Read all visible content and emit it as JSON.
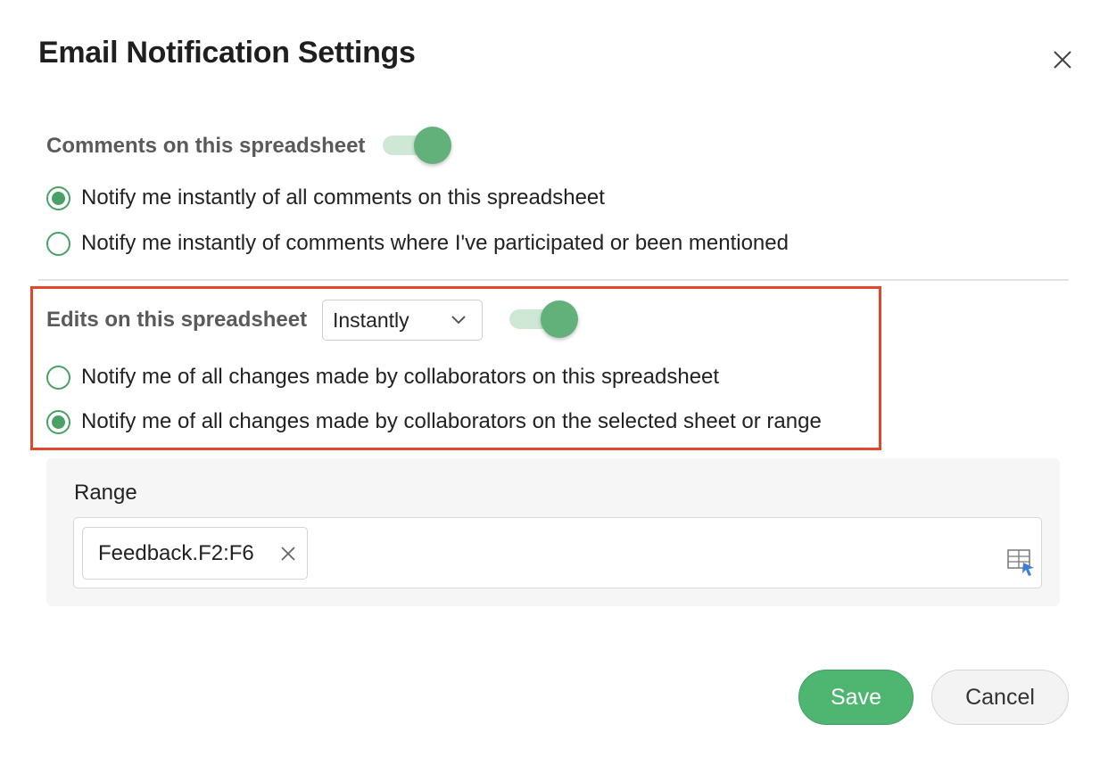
{
  "dialog": {
    "title": "Email Notification Settings",
    "close_icon": "close-icon"
  },
  "comments": {
    "label": "Comments on this spreadsheet",
    "toggle_on": true,
    "options": [
      {
        "label": "Notify me instantly of all comments on this spreadsheet",
        "selected": true
      },
      {
        "label": "Notify me instantly of comments where I've participated or been mentioned",
        "selected": false
      }
    ]
  },
  "edits": {
    "label": "Edits on this spreadsheet",
    "frequency": "Instantly",
    "toggle_on": true,
    "options": [
      {
        "label": "Notify me of all changes made by collaborators on this spreadsheet",
        "selected": false
      },
      {
        "label": "Notify me of all changes made by collaborators on the selected sheet or range",
        "selected": true
      }
    ]
  },
  "range": {
    "label": "Range",
    "chips": [
      "Feedback.F2:F6"
    ]
  },
  "actions": {
    "save": "Save",
    "cancel": "Cancel"
  },
  "colors": {
    "accent_green": "#4fb672",
    "toggle_knob": "#62b07a",
    "highlight_border": "#e0472b"
  }
}
